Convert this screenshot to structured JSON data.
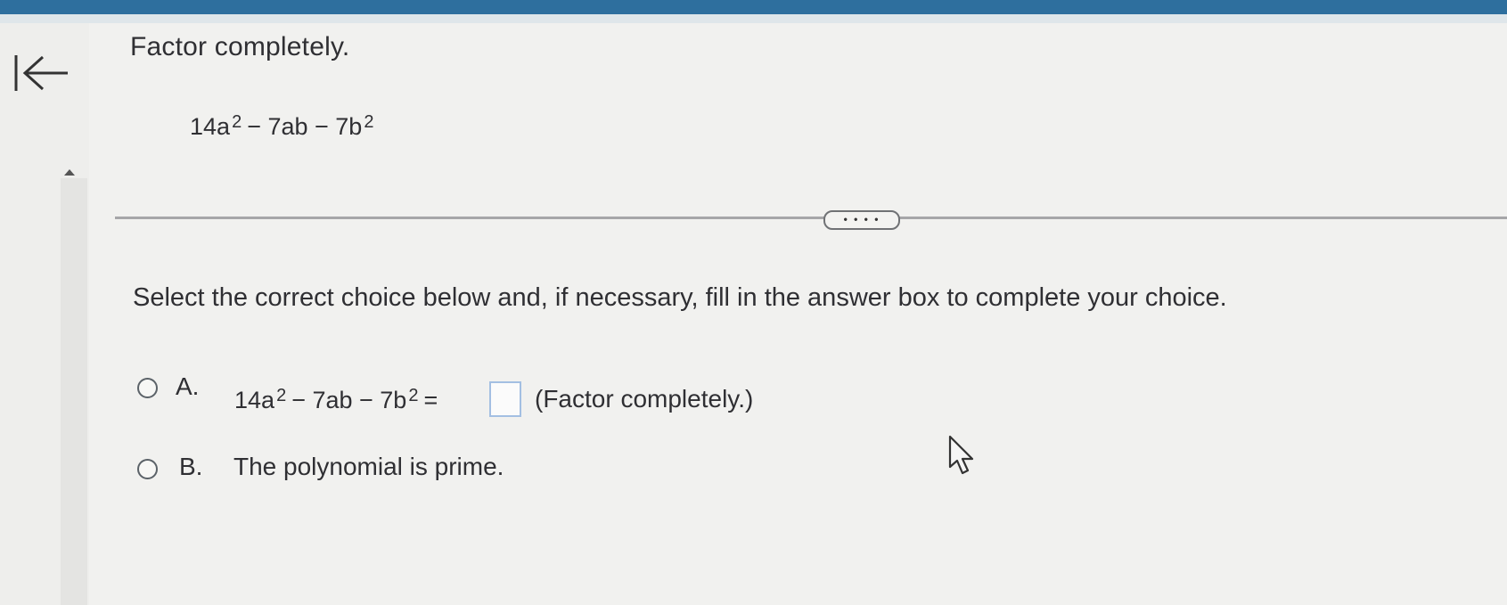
{
  "question": {
    "title": "Factor completely.",
    "expression": {
      "term1_coef": "14a",
      "term1_exp": "2",
      "middle": "− 7ab − 7b",
      "term3_exp": "2"
    }
  },
  "more_button_label": "• • • •",
  "instruction": "Select the correct choice below and, if necessary, fill in the answer box to complete your choice.",
  "choices": {
    "a": {
      "letter": "A.",
      "expr_part1": "14a",
      "expr_exp1": "2",
      "expr_part2": "− 7ab − 7b",
      "expr_exp2": "2",
      "equals": "=",
      "answer_value": "",
      "note": "(Factor completely.)"
    },
    "b": {
      "letter": "B.",
      "text": "The polynomial is prime."
    }
  },
  "icons": {
    "collapse": "collapse-left-arrow-icon",
    "scroll_up": "triangle-up-icon",
    "cursor": "mouse-pointer-icon"
  },
  "colors": {
    "header": "#2e6f9e",
    "answer_box_border": "#a3bfe2"
  }
}
